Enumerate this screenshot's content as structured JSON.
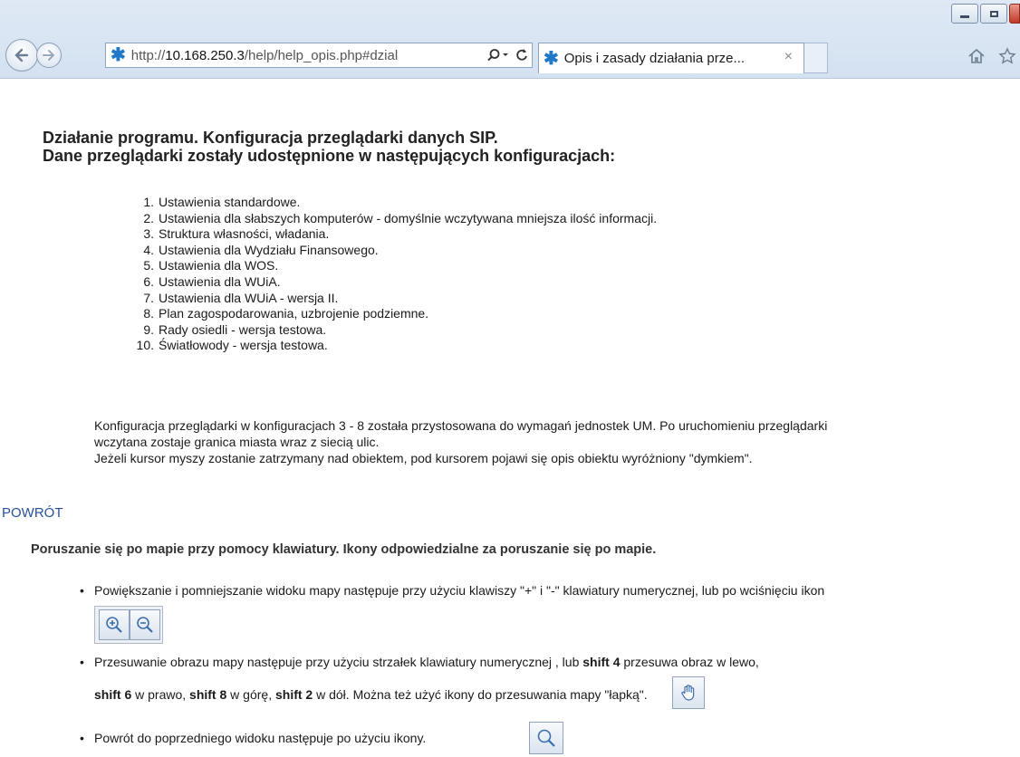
{
  "browser": {
    "url_prefix": "http://",
    "url_host": "10.168.250.3",
    "url_path": "/help/help_opis.php#dzial",
    "tab_title": "Opis i zasady działania prze...",
    "tab_close": "×"
  },
  "page": {
    "heading_line1": "Działanie programu. Konfiguracja przeglądarki danych SIP.",
    "heading_line2": "Dane przeglądarki zostały udostępnione w następujących konfiguracjach:",
    "configs": [
      {
        "num": "1.",
        "text": "Ustawienia standardowe."
      },
      {
        "num": "2.",
        "text": "Ustawienia dla słabszych komputerów - domyślnie wczytywana mniejsza ilość informacji."
      },
      {
        "num": "3.",
        "text": "Struktura własności, władania."
      },
      {
        "num": "4.",
        "text": "Ustawienia dla Wydziału Finansowego."
      },
      {
        "num": "5.",
        "text": "Ustawienia dla WOS."
      },
      {
        "num": "6.",
        "text": "Ustawienia dla WUiA."
      },
      {
        "num": "7.",
        "text": "Ustawienia dla WUiA - wersja II."
      },
      {
        "num": "8.",
        "text": "Plan zagospodarowania, uzbrojenie podziemne."
      },
      {
        "num": "9.",
        "text": "Rady osiedli - wersja testowa."
      },
      {
        "num": "10.",
        "text": "Światłowody - wersja testowa."
      }
    ],
    "para_line1": "Konfiguracja przeglądarki w konfiguracjach 3 - 8 została przystosowana do wymagań jednostek UM. Po uruchomieniu przeglądarki",
    "para_line2": "wczytana zostaje granica miasta wraz z siecią ulic.",
    "para_line3": "Jeżeli kursor myszy zostanie zatrzymany nad obiektem, pod kursorem pojawi się opis obiektu wyróżniony \"dymkiem\".",
    "back_link": "POWRÓT",
    "section2_heading": "Poruszanie się po mapie przy pomocy klawiatury. Ikony odpowiedzialne za poruszanie się po mapie.",
    "bullet": "•",
    "b1_text": "Powiększanie i pomniejszanie widoku mapy następuje przy użyciu klawiszy \"+\" i \"-\" klawiatury numerycznej, lub po wciśnięciu ikon",
    "b2_a": "Przesuwanie obrazu mapy następuje przy użyciu strzałek klawiatury numerycznej , lub ",
    "b2_k1": "shift 4",
    "b2_b": " przesuwa obraz w lewo,",
    "b2_k2": "shift 6",
    "b2_c": " w prawo, ",
    "b2_k3": "shift 8",
    "b2_d": " w górę, ",
    "b2_k4": "shift 2",
    "b2_e": " w dół. Można też użyć ikony do przesuwania mapy \"łapką\".",
    "b3_text": "Powrót do poprzedniego widoku następuje po użyciu ikony."
  },
  "colors": {
    "link": "#27519a",
    "chrome": "#d3e1f1",
    "accent_star": "#1f78c8"
  }
}
